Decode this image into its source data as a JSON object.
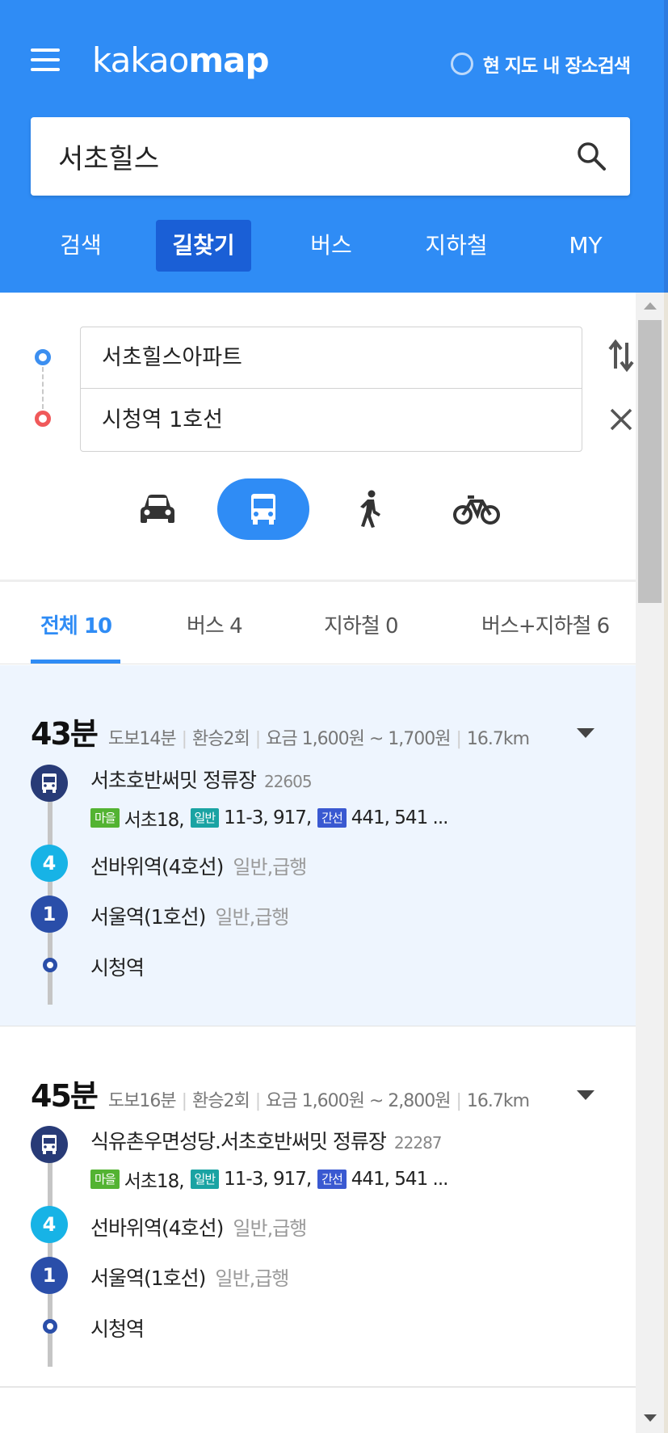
{
  "header": {
    "logo_light": "kakao",
    "logo_bold": "map",
    "area_search_label": "현 지도 내 장소검색",
    "search_value": "서초힐스",
    "tabs": [
      {
        "label": "검색",
        "active": false
      },
      {
        "label": "길찾기",
        "active": true
      },
      {
        "label": "버스",
        "active": false
      },
      {
        "label": "지하철",
        "active": false
      },
      {
        "label": "MY",
        "active": false
      }
    ]
  },
  "route": {
    "origin": "서초힐스아파트",
    "destination": "시청역 1호선",
    "modes": [
      {
        "icon": "car-icon",
        "active": false
      },
      {
        "icon": "bus-icon",
        "active": true
      },
      {
        "icon": "walk-icon",
        "active": false
      },
      {
        "icon": "bicycle-icon",
        "active": false
      }
    ]
  },
  "filter_tabs": [
    {
      "label": "전체 10",
      "active": true
    },
    {
      "label": "버스 4",
      "active": false
    },
    {
      "label": "지하철 0",
      "active": false
    },
    {
      "label": "버스+지하철 6",
      "active": false
    }
  ],
  "results": [
    {
      "minutes": "43분",
      "walk": "도보14분",
      "transfers": "환승2회",
      "fare": "요금 1,600원 ~ 1,700원",
      "distance": "16.7km",
      "bus_stop": "서초호반써밋 정류장",
      "bus_stop_id": "22605",
      "tag_village": "마을",
      "village_lines": "서초18,",
      "tag_general": "일반",
      "general_lines": "11-3, 917,",
      "tag_trunk": "간선",
      "trunk_lines": "441, 541 ...",
      "line4_badge": "4",
      "station1": "선바위역(4호선)",
      "station1_type": "일반,급행",
      "line1_badge": "1",
      "station2": "서울역(1호선)",
      "station2_type": "일반,급행",
      "end_station": "시청역"
    },
    {
      "minutes": "45분",
      "walk": "도보16분",
      "transfers": "환승2회",
      "fare": "요금 1,600원 ~ 2,800원",
      "distance": "16.7km",
      "bus_stop": "식유촌우면성당.서초호반써밋 정류장",
      "bus_stop_id": "22287",
      "tag_village": "마을",
      "village_lines": "서초18,",
      "tag_general": "일반",
      "general_lines": "11-3, 917,",
      "tag_trunk": "간선",
      "trunk_lines": "441, 541 ...",
      "line4_badge": "4",
      "station1": "선바위역(4호선)",
      "station1_type": "일반,급행",
      "line1_badge": "1",
      "station2": "서울역(1호선)",
      "station2_type": "일반,급행",
      "end_station": "시청역"
    }
  ],
  "colors": {
    "brand_blue": "#2f8cf5",
    "active_tab_bg": "#1a5fd6",
    "bus_badge": "#283b77",
    "line4": "#17b3e6",
    "line1": "#2a4ea9",
    "origin_dot": "#3c8ff0",
    "destination_dot": "#f0595a"
  }
}
